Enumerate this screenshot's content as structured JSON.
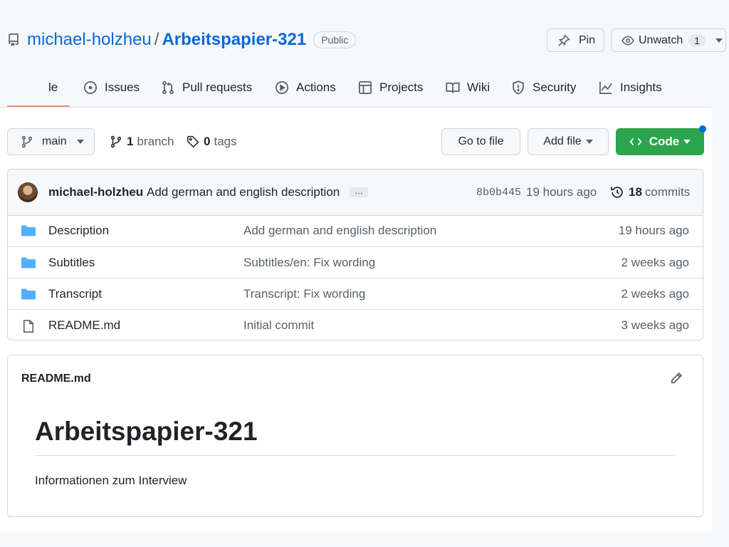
{
  "repo": {
    "owner": "michael-holzheu",
    "slash": "/",
    "name": "Arbeitspapier-321",
    "visibility": "Public",
    "pin_label": "Pin",
    "unwatch_label": "Unwatch",
    "watch_count": "1"
  },
  "tabs": [
    {
      "label": "le",
      "icon": "code-icon"
    },
    {
      "label": "Issues",
      "icon": "issue-icon"
    },
    {
      "label": "Pull requests",
      "icon": "pull-request-icon"
    },
    {
      "label": "Actions",
      "icon": "play-icon"
    },
    {
      "label": "Projects",
      "icon": "table-icon"
    },
    {
      "label": "Wiki",
      "icon": "book-icon"
    },
    {
      "label": "Security",
      "icon": "shield-icon"
    },
    {
      "label": "Insights",
      "icon": "graph-icon"
    }
  ],
  "toolbar": {
    "branch_name": "main",
    "branch_count": "1",
    "branch_word": "branch",
    "tag_count": "0",
    "tag_word": "tags",
    "go_to_file": "Go to file",
    "add_file": "Add file",
    "code": "Code"
  },
  "commit": {
    "author": "michael-holzheu",
    "message": "Add german and english description",
    "ellipsis": "…",
    "sha": "8b0b445",
    "time": "19 hours ago",
    "count": "18",
    "count_word": "commits"
  },
  "files": [
    {
      "type": "folder",
      "name": "Description",
      "message": "Add german and english description",
      "time": "19 hours ago"
    },
    {
      "type": "folder",
      "name": "Subtitles",
      "message": "Subtitles/en: Fix wording",
      "time": "2 weeks ago"
    },
    {
      "type": "folder",
      "name": "Transcript",
      "message": "Transcript: Fix wording",
      "time": "2 weeks ago"
    },
    {
      "type": "file",
      "name": "README.md",
      "message": "Initial commit",
      "time": "3 weeks ago"
    }
  ],
  "readme": {
    "title": "README.md",
    "heading": "Arbeitspapier-321",
    "paragraph": "Informationen zum Interview"
  },
  "colors": {
    "accent": "#0969da",
    "code_button": "#2da44e",
    "tab_underline": "#fd8c73",
    "folder": "#54aeff"
  }
}
